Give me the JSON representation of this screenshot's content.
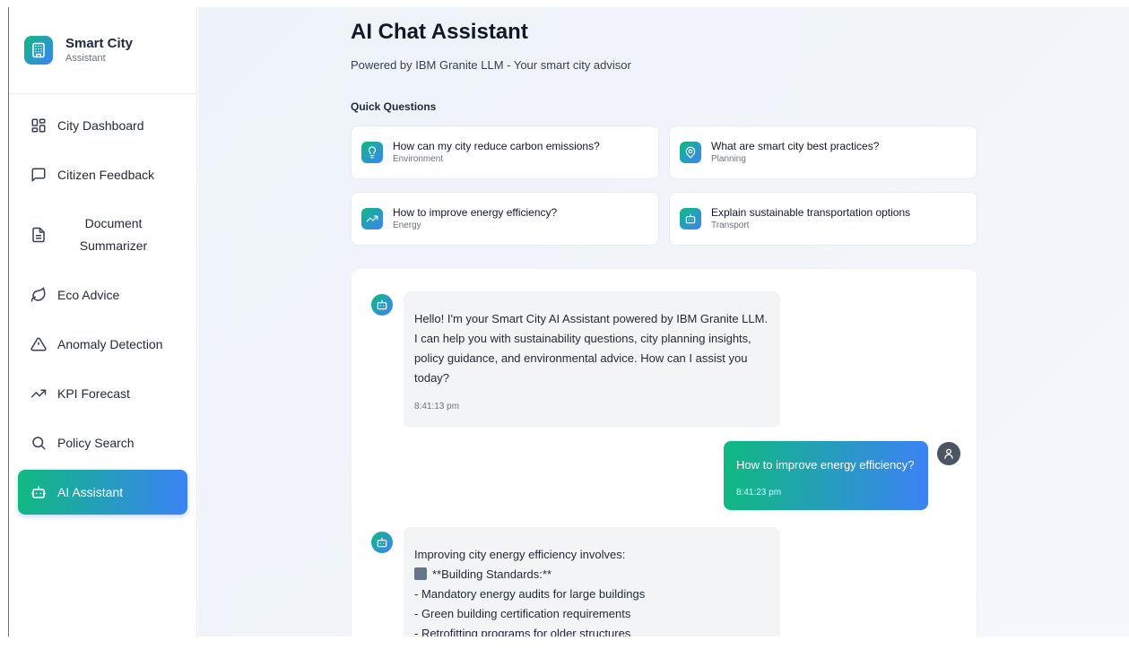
{
  "sidebar": {
    "brand_title": "Smart City",
    "brand_subtitle": "Assistant",
    "items": [
      {
        "label": "City Dashboard",
        "icon": "dashboard-icon"
      },
      {
        "label": "Citizen Feedback",
        "icon": "message-icon"
      },
      {
        "label": "Document Summarizer",
        "icon": "document-icon"
      },
      {
        "label": "Eco Advice",
        "icon": "leaf-icon"
      },
      {
        "label": "Anomaly Detection",
        "icon": "warning-icon"
      },
      {
        "label": "KPI Forecast",
        "icon": "trend-icon"
      },
      {
        "label": "Policy Search",
        "icon": "search-icon"
      },
      {
        "label": "AI Assistant",
        "icon": "bot-icon",
        "active": true
      }
    ]
  },
  "main": {
    "title": "AI Chat Assistant",
    "subtitle": "Powered by IBM Granite LLM - Your smart city advisor",
    "quick_label": "Quick Questions",
    "quick_questions": [
      {
        "question": "How can my city reduce carbon emissions?",
        "category": "Environment",
        "icon": "lightbulb-icon"
      },
      {
        "question": "What are smart city best practices?",
        "category": "Planning",
        "icon": "map-pin-icon"
      },
      {
        "question": "How to improve energy efficiency?",
        "category": "Energy",
        "icon": "trend-icon"
      },
      {
        "question": "Explain sustainable transportation options",
        "category": "Transport",
        "icon": "bot-icon"
      }
    ],
    "messages": [
      {
        "role": "bot",
        "text": "Hello! I'm your Smart City AI Assistant powered by IBM Granite LLM. I can help you with sustainability questions, city planning insights, policy guidance, and environmental advice. How can I assist you today?",
        "time": "8:41:13 pm"
      },
      {
        "role": "user",
        "text": "How to improve energy efficiency?",
        "time": "8:41:23 pm"
      },
      {
        "role": "bot",
        "lines": [
          "Improving city energy efficiency involves:",
          "",
          "**Building Standards:**",
          "- Mandatory energy audits for large buildings",
          "- Green building certification requirements",
          "- Retrofitting programs for older structures"
        ]
      }
    ]
  },
  "colors": {
    "accent_start": "#10b981",
    "accent_end": "#3b82f6",
    "bubble_bg": "#f3f4f6",
    "user_avatar": "#4b5563"
  }
}
